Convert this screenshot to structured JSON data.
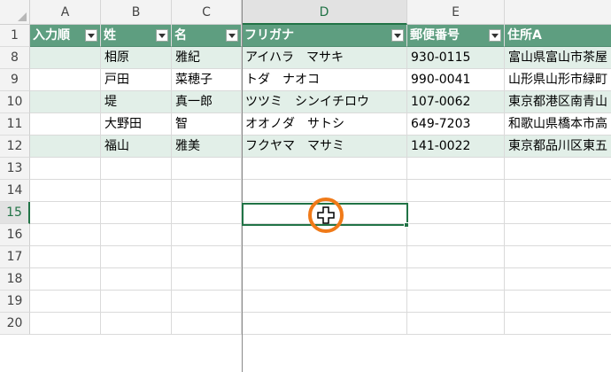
{
  "columns": [
    "A",
    "B",
    "C",
    "D",
    "E",
    ""
  ],
  "selected_column": "D",
  "table_header": [
    "入力順",
    "姓",
    "名",
    "フリガナ",
    "郵便番号",
    "住所A"
  ],
  "rows": [
    {
      "row": "8",
      "cells": [
        "",
        "相原",
        "雅紀",
        "アイハラ　マサキ",
        "930-0115",
        "富山県富山市茶屋"
      ]
    },
    {
      "row": "9",
      "cells": [
        "",
        "戸田",
        "菜穂子",
        "トダ　ナオコ",
        "990-0041",
        "山形県山形市緑町"
      ]
    },
    {
      "row": "10",
      "cells": [
        "",
        "堤",
        "真一郎",
        "ツツミ　シンイチロウ",
        "107-0062",
        "東京都港区南青山"
      ]
    },
    {
      "row": "11",
      "cells": [
        "",
        "大野田",
        "智",
        "オオノダ　サトシ",
        "649-7203",
        "和歌山県橋本市高"
      ]
    },
    {
      "row": "12",
      "cells": [
        "",
        "福山",
        "雅美",
        "フクヤマ　マサミ",
        "141-0022",
        "東京都品川区東五"
      ]
    }
  ],
  "header_row_number": "1",
  "empty_rows": [
    "13",
    "14",
    "15",
    "16",
    "17",
    "18",
    "19",
    "20"
  ],
  "selected_row": "15",
  "colors": {
    "header": "#5e9e80",
    "band": "#e2efe8",
    "select": "#217346",
    "highlight_ring": "#f07a18"
  },
  "icons": {
    "filter": "filter-dropdown-icon",
    "cursor": "plus-cursor-icon",
    "corner": "select-all-triangle-icon"
  }
}
